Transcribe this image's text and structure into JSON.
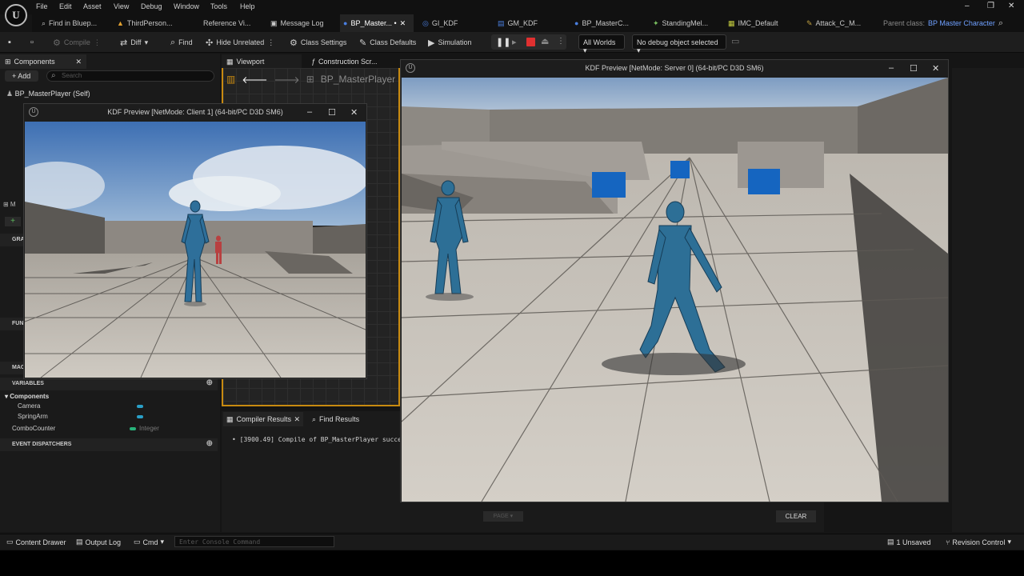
{
  "menu": [
    "File",
    "Edit",
    "Asset",
    "View",
    "Debug",
    "Window",
    "Tools",
    "Help"
  ],
  "tabs": [
    {
      "label": "Find in Bluep...",
      "icon": "search-icon",
      "color": "#bbb"
    },
    {
      "label": "ThirdPerson...",
      "icon": "map-icon",
      "color": "#e0a030"
    },
    {
      "label": "Reference Vi...",
      "icon": "reference-icon",
      "color": "#bbb"
    },
    {
      "label": "Message Log",
      "icon": "log-icon",
      "color": "#bbb"
    },
    {
      "label": "BP_Master... •",
      "icon": "character-icon",
      "color": "#4a7fe0"
    },
    {
      "label": "GI_KDF",
      "icon": "instance-icon",
      "color": "#4a7fe0"
    },
    {
      "label": "GM_KDF",
      "icon": "gamemode-icon",
      "color": "#4a7fe0"
    },
    {
      "label": "BP_MasterC...",
      "icon": "character-icon",
      "color": "#4a7fe0"
    },
    {
      "label": "StandingMel...",
      "icon": "anim-icon",
      "color": "#7ac060"
    },
    {
      "label": "IMC_Default",
      "icon": "input-icon",
      "color": "#c8d040"
    },
    {
      "label": "Attack_C_M...",
      "icon": "montage-icon",
      "color": "#c0a040"
    }
  ],
  "parent_class_label": "Parent class:",
  "parent_class_value": "BP Master Character",
  "toolbar": {
    "compile": "Compile",
    "diff": "Diff",
    "find": "Find",
    "hide_unrelated": "Hide Unrelated",
    "class_settings": "Class Settings",
    "class_defaults": "Class Defaults",
    "simulation": "Simulation",
    "world": "All Worlds",
    "debug_object": "No debug object selected"
  },
  "components": {
    "tab": "Components",
    "add": "+ Add",
    "search_placeholder": "Search",
    "root": "BP_MasterPlayer (Self)"
  },
  "myblueprint": {
    "graphs": "GRA",
    "functions": "FUN",
    "macros": "MAC",
    "variables_header": "VARIABLES",
    "components_header": "Components",
    "vars": [
      {
        "name": "Camera",
        "type": ""
      },
      {
        "name": "SpringArm",
        "type": ""
      }
    ],
    "combo_name": "ComboCounter",
    "combo_type": "Integer",
    "dispatchers": "EVENT DISPATCHERS"
  },
  "center_tabs": {
    "viewport": "Viewport",
    "construction": "Construction Scr...",
    "breadcrumb": "BP_MasterPlayer"
  },
  "client_window": {
    "title": "KDF Preview [NetMode: Client 1]  (64-bit/PC D3D SM6)"
  },
  "server_window": {
    "title": "KDF Preview [NetMode: Server 0]  (64-bit/PC D3D SM6)"
  },
  "compiler": {
    "tab1": "Compiler Results",
    "tab2": "Find Results",
    "message": "[3900.49] Compile of BP_MasterPlayer succe"
  },
  "log": {
    "page": "PAGE",
    "clear": "CLEAR"
  },
  "status": {
    "content_drawer": "Content Drawer",
    "output_log": "Output Log",
    "cmd": "Cmd",
    "console_placeholder": "Enter Console Command",
    "unsaved": "1 Unsaved",
    "revision": "Revision Control"
  }
}
